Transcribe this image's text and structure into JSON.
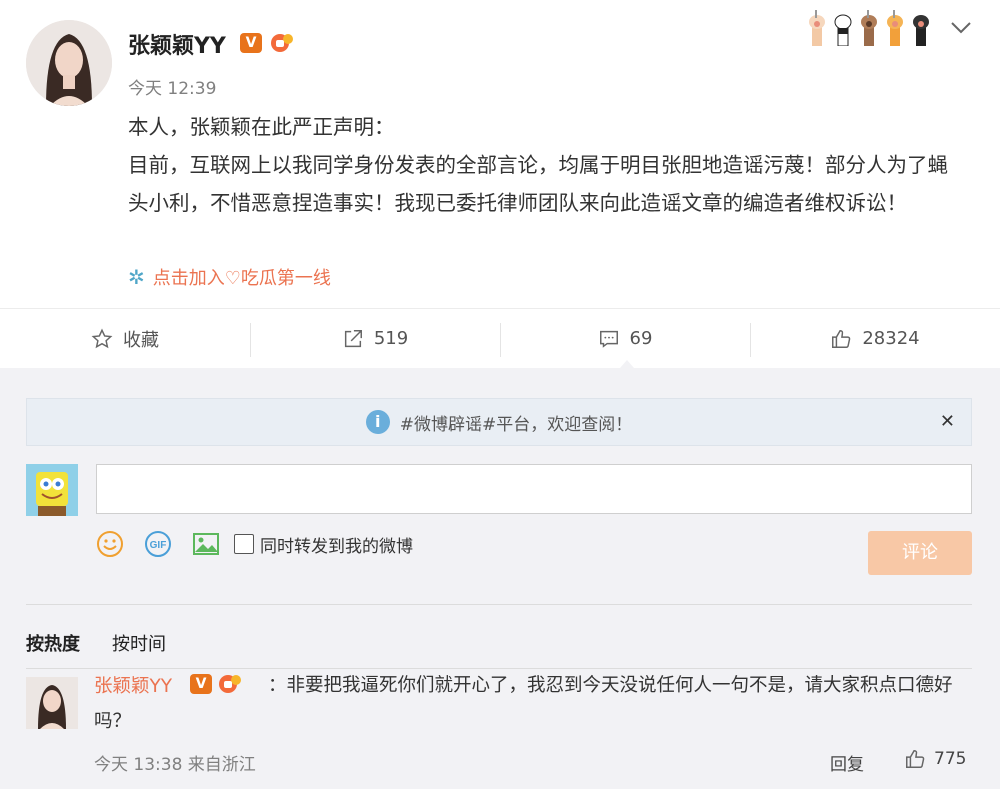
{
  "post": {
    "username": "张颖颖YY",
    "verified_badge": "V",
    "time": "今天 12:39",
    "lines": [
      "本人，张颖颖在此严正声明：",
      "目前，互联网上以我同学身份发表的全部言论，均属于明目张胆地造谣污蔑！部分人为了蝇头小利，不惜恶意捏造事实！我现已委托律师团队来向此造谣文章的编造者维权诉讼！"
    ],
    "supertopic": "点击加入♡吃瓜第一线"
  },
  "actions": {
    "favorite_label": "收藏",
    "repost_count": "519",
    "comment_count": "69",
    "like_count": "28324"
  },
  "notice": {
    "text": "#微博辟谣#平台，欢迎查阅！"
  },
  "composer": {
    "forward_label": "同时转发到我的微博",
    "submit_label": "评论"
  },
  "sort": {
    "hot": "按热度",
    "time": "按时间"
  },
  "comment": {
    "username": "张颖颖YY",
    "verified_badge": "V",
    "text": "：非要把我逼死你们就开心了，我忍到今天没说任何人一句不是，请大家积点口德好吗？",
    "meta": "今天 13:38 来自浙江",
    "reply_label": "回复",
    "like_count": "775"
  },
  "colors": {
    "accent": "#eb7350",
    "submit_disabled": "#f8c8a6",
    "link_icon": "#4fa6c8"
  },
  "icons": [
    "star-icon",
    "share-icon",
    "comment-icon",
    "thumbs-up-icon",
    "info-icon",
    "close-icon",
    "emoji-icon",
    "gif-icon",
    "image-icon",
    "chevron-down-icon",
    "supertopic-icon",
    "cat-paw-icon"
  ]
}
